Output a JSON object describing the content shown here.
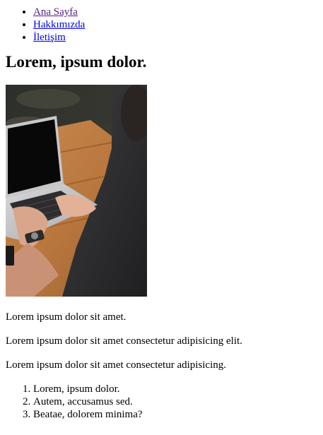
{
  "nav": {
    "items": [
      {
        "label": "Ana Sayfa",
        "visited": true
      },
      {
        "label": "Hakkımızda",
        "visited": false
      },
      {
        "label": "İletişim",
        "visited": false
      }
    ]
  },
  "main": {
    "title": "Lorem, ipsum dolor.",
    "image": {
      "subject": "person typing on a laptop at a wooden table"
    },
    "paragraphs": [
      "Lorem ipsum dolor sit amet.",
      "Lorem ipsum dolor sit amet consectetur adipisicing elit.",
      "Lorem ipsum dolor sit amet consectetur adipisicing."
    ],
    "list": [
      "Lorem, ipsum dolor.",
      "Autem, accusamus sed.",
      "Beatae, dolorem minima?"
    ]
  },
  "colors": {
    "link": "#0000ee",
    "link_visited": "#551a8b",
    "text": "#000000",
    "background": "#ffffff"
  }
}
